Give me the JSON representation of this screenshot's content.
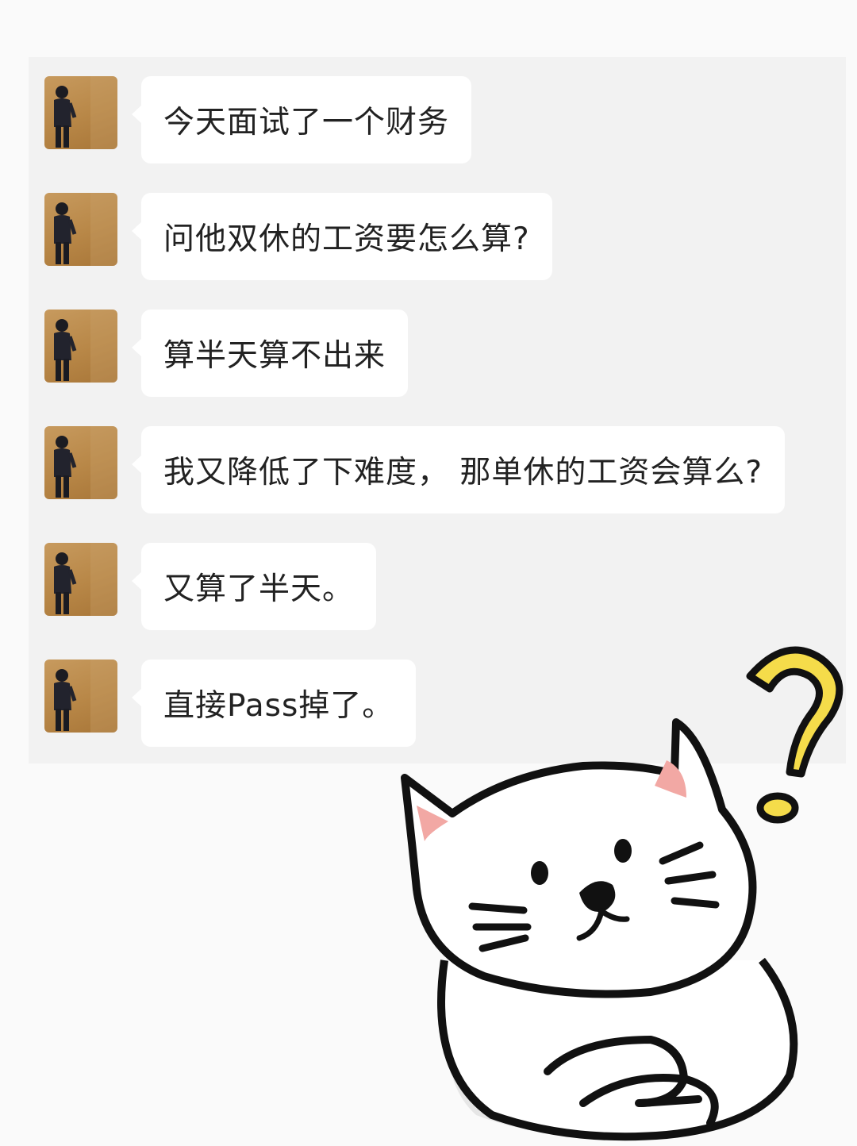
{
  "chat": {
    "messages": [
      {
        "text": "今天面试了一个财务"
      },
      {
        "text": "问他双休的工资要怎么算?"
      },
      {
        "text": "算半天算不出来"
      },
      {
        "text": "我又降低了下难度， 那单休的工资会算么?"
      },
      {
        "text": "又算了半天。"
      },
      {
        "text": "直接Pass掉了。"
      }
    ]
  },
  "colors": {
    "page_background": "#fafafa",
    "chat_background": "#f2f2f2",
    "bubble": "#ffffff",
    "text": "#222222",
    "question_mark": "#f5dc4a",
    "cat_ear_inner": "#f2a8a4"
  },
  "sticker": {
    "icon": "confused-cat-icon",
    "accent_icon": "question-mark-icon"
  }
}
